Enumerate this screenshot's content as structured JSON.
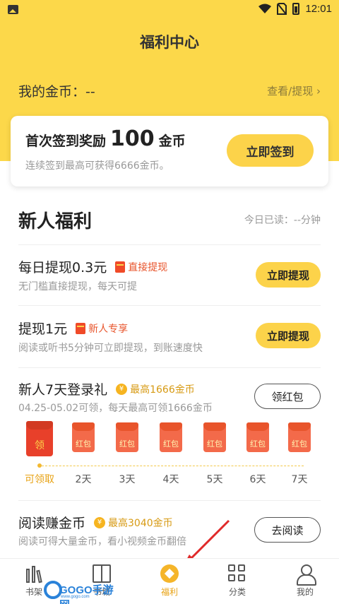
{
  "status": {
    "time": "12:01"
  },
  "header": {
    "title": "福利中心",
    "coins_label": "我的金币：--",
    "withdraw_link": "查看/提现 ›"
  },
  "signin": {
    "title_prefix": "首次签到奖励",
    "amount": "100",
    "title_suffix": "金币",
    "subtitle": "连续签到最高可获得6666金币。",
    "button": "立即签到"
  },
  "section": {
    "title": "新人福利",
    "today_read": "今日已读：--分钟"
  },
  "tasks": [
    {
      "title": "每日提现0.3元",
      "tag": "直接提现",
      "sub": "无门槛直接提现，每天可提",
      "button": "立即提现"
    },
    {
      "title": "提现1元",
      "tag": "新人专享",
      "sub": "阅读或听书5分钟可立即提现，到账速度快",
      "button": "立即提现"
    },
    {
      "title": "新人7天登录礼",
      "tag": "最高1666金币",
      "sub": "04.25-05.02可领，每天最高可领1666金币",
      "button": "领红包"
    },
    {
      "title": "阅读赚金币",
      "tag": "最高3040金币",
      "sub": "阅读可得大量金币，看小视频金币翻倍",
      "button": "去阅读"
    }
  ],
  "login_days": {
    "first_envelope": "领",
    "envelope_label": "红包",
    "labels": [
      "可领取",
      "2天",
      "3天",
      "4天",
      "5天",
      "6天",
      "7天"
    ]
  },
  "coin_icon_glyph": "¥",
  "nav": {
    "items": [
      "书架",
      "书城",
      "福利",
      "分类",
      "我的"
    ],
    "active": "福利"
  },
  "watermark": {
    "text": "GOGO手游网",
    "small": "www.gogo.com"
  },
  "colors": {
    "brand_yellow": "#fcd84a",
    "accent_orange": "#e8a316",
    "red_tag": "#e8542b"
  }
}
